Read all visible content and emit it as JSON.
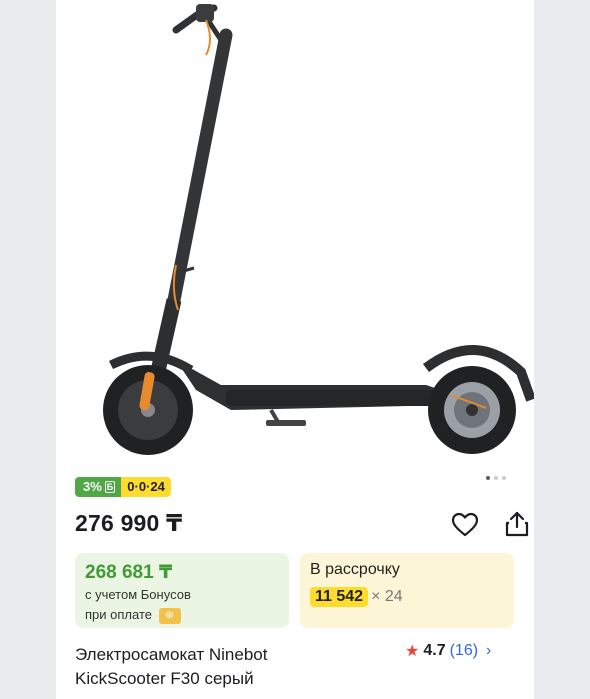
{
  "product": {
    "image_alt_icon": "scooter-product-image",
    "carousel": {
      "total": 3,
      "active": 0
    },
    "badges": {
      "bonus": "3%",
      "bonus_icon": "Б",
      "installment": "0·0·24"
    },
    "price": "276 990 ₸",
    "bonus_box": {
      "price": "268 681 ₸",
      "label_line1": "с учетом Бонусов",
      "label_line2": "при оплате"
    },
    "installment_box": {
      "label": "В рассрочку",
      "amount": "11 542",
      "multiplier": "× 24"
    },
    "title_line1": "Электросамокат Ninebot",
    "title_line2": "KickScooter F30 серый",
    "rating": {
      "value": "4.7",
      "count": "(16)"
    },
    "colors": {
      "bonus_green": "#4fa845",
      "installment_yellow": "#fddc2e",
      "link_blue": "#3169d6",
      "star_red": "#e5473a",
      "scooter_accent": "#e88a2e"
    }
  }
}
